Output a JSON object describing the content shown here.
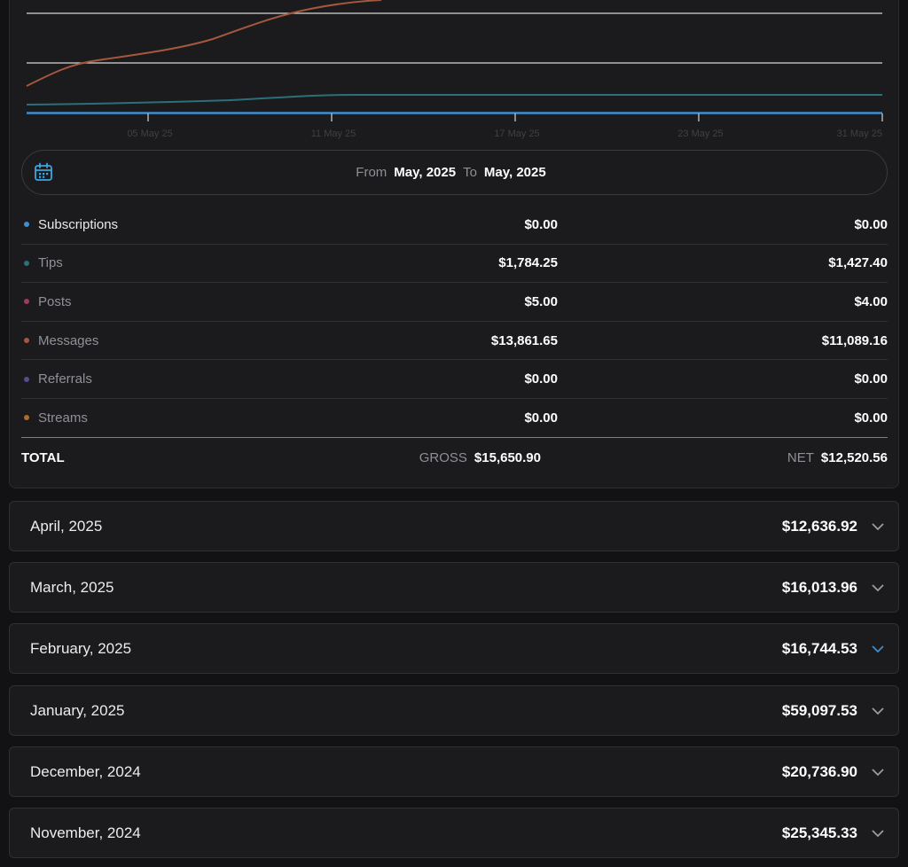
{
  "chart": {
    "x_ticks": [
      "05 May 25",
      "11 May 25",
      "17 May 25",
      "23 May 25",
      "31 May 25"
    ],
    "colors": {
      "subscriptions": "#3e8fd0",
      "tips": "#2c6f7a",
      "messages": "#a4583e",
      "gridline": "#d8d8d8"
    }
  },
  "date_range": {
    "icon": "calendar-icon",
    "from_label": "From",
    "from_value": "May, 2025",
    "to_label": "To",
    "to_value": "May, 2025"
  },
  "categories": [
    {
      "name": "Subscriptions",
      "gross": "$0.00",
      "net": "$0.00",
      "color": "#3e8fd0"
    },
    {
      "name": "Tips",
      "gross": "$1,784.25",
      "net": "$1,427.40",
      "color": "#2c6f7a"
    },
    {
      "name": "Posts",
      "gross": "$5.00",
      "net": "$4.00",
      "color": "#a33a5a"
    },
    {
      "name": "Messages",
      "gross": "$13,861.65",
      "net": "$11,089.16",
      "color": "#a4583e"
    },
    {
      "name": "Referrals",
      "gross": "$0.00",
      "net": "$0.00",
      "color": "#5b4a8c"
    },
    {
      "name": "Streams",
      "gross": "$0.00",
      "net": "$0.00",
      "color": "#b06a2c"
    }
  ],
  "total": {
    "label": "TOTAL",
    "gross_label": "GROSS",
    "gross_value": "$15,650.90",
    "net_label": "NET",
    "net_value": "$12,520.56"
  },
  "months": [
    {
      "name": "April, 2025",
      "total": "$12,636.92"
    },
    {
      "name": "March, 2025",
      "total": "$16,013.96"
    },
    {
      "name": "February, 2025",
      "total": "$16,744.53"
    },
    {
      "name": "January, 2025",
      "total": "$59,097.53"
    },
    {
      "name": "December, 2024",
      "total": "$20,736.90"
    },
    {
      "name": "November, 2024",
      "total": "$25,345.33"
    }
  ],
  "accent_chevron_color": "#3e8fd0",
  "chevron_color": "#9a9ca1"
}
